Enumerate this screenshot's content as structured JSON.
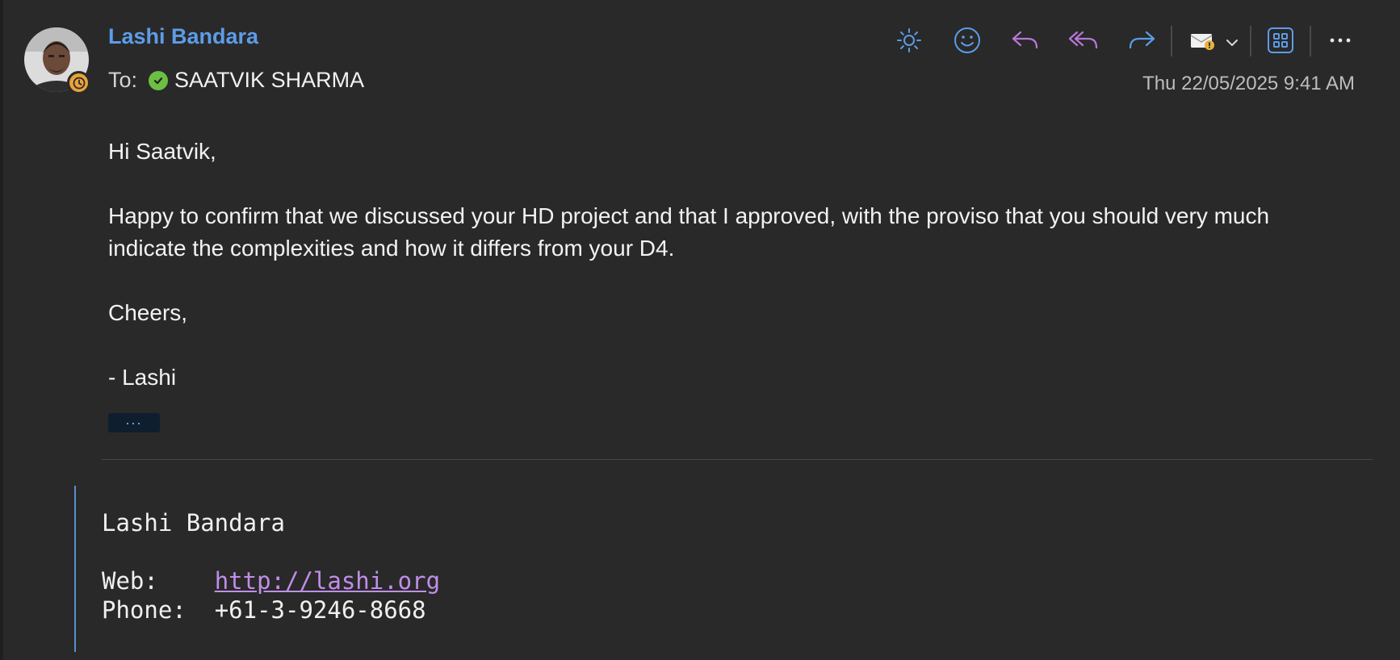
{
  "message": {
    "sender_name": "Lashi Bandara",
    "to_label": "To:",
    "recipient": "SAATVIK SHARMA",
    "timestamp": "Thu 22/05/2025 9:41 AM"
  },
  "body": {
    "greeting": "Hi Saatvik,",
    "paragraph": "Happy to confirm that we discussed your HD project and that I approved, with the proviso that you should very much indicate the complexities and how it differs from your D4.",
    "closing": "Cheers,",
    "sign_off": "- Lashi",
    "expand_label": "..."
  },
  "signature": {
    "name": "Lashi Bandara",
    "web_label": "Web:",
    "web_url": "http://lashi.org",
    "phone_label": "Phone:",
    "phone": "+61-3-9246-8668"
  },
  "icons": {
    "toolbar": [
      "brightness-icon",
      "emoji-icon",
      "reply-icon",
      "reply-all-icon",
      "forward-icon",
      "rules-icon",
      "dropdown-chevron-icon",
      "apps-icon",
      "more-icon"
    ],
    "presence": "clock-icon",
    "recipient_status": "check-icon"
  },
  "colors": {
    "background": "#292929",
    "sender": "#5d9ce8",
    "reply_icons": "#b877d6",
    "toolbar_icons": "#5d9ce8",
    "presence_away": "#e9a23b",
    "recipient_ok": "#6cbf43",
    "link": "#c08ee8",
    "quote_bar": "#5a8fc9"
  }
}
